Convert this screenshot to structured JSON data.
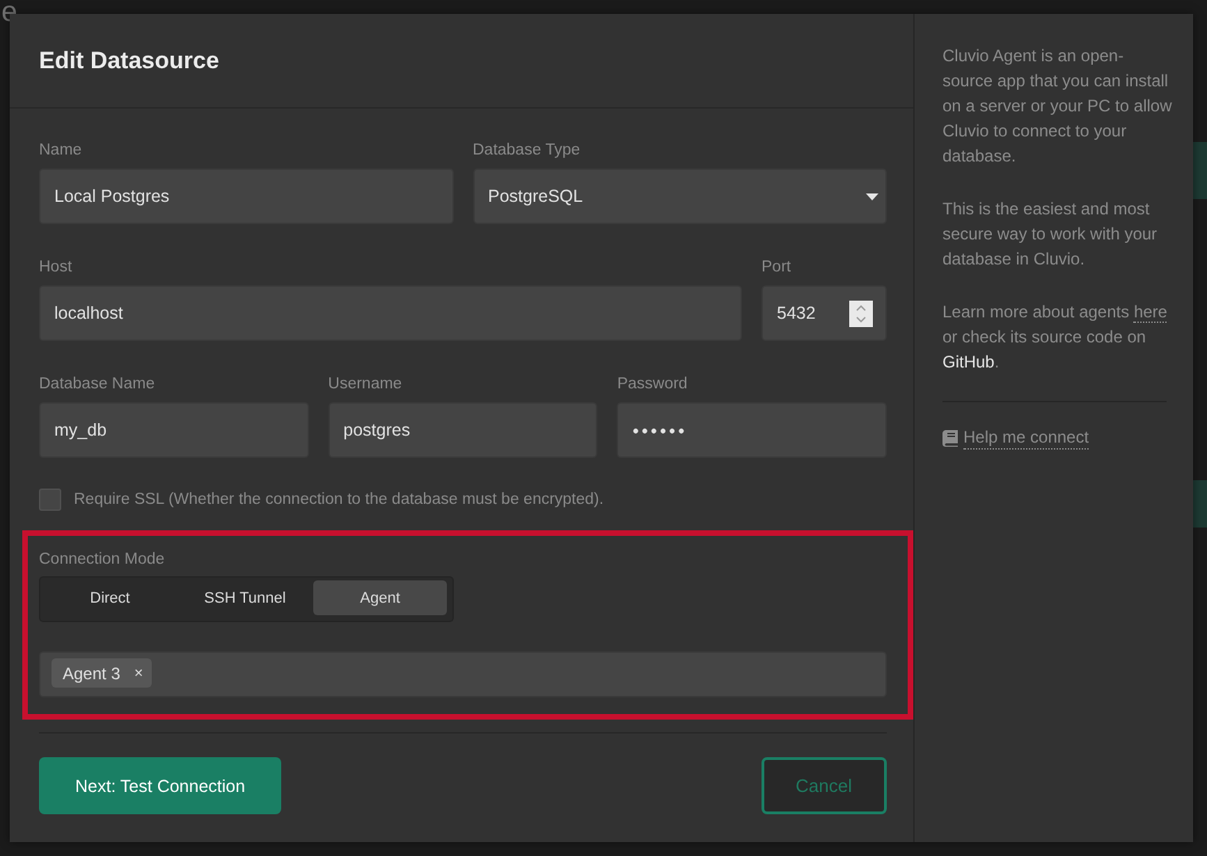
{
  "background_page": {
    "title": "e"
  },
  "dialog": {
    "title": "Edit Datasource",
    "rows": [
      [
        {
          "label": "Name",
          "kind": "text",
          "value": "Local Postgres"
        },
        {
          "label": "Database Type",
          "kind": "select",
          "value": "PostgreSQL"
        }
      ],
      [
        {
          "label": "Host",
          "kind": "text",
          "value": "localhost"
        },
        {
          "label": "Port",
          "kind": "number",
          "value": "5432"
        }
      ],
      [
        {
          "label": "Database Name",
          "kind": "text",
          "value": "my_db"
        },
        {
          "label": "Username",
          "kind": "text",
          "value": "postgres"
        },
        {
          "label": "Password",
          "kind": "password",
          "value": "••••••"
        }
      ]
    ],
    "ssl": {
      "label": "Require SSL (Whether the connection to the database must be encrypted).",
      "checked": false
    },
    "connection_mode": {
      "label": "Connection Mode",
      "highlighted": true,
      "options": [
        {
          "label": "Direct",
          "selected": false
        },
        {
          "label": "SSH Tunnel",
          "selected": false
        },
        {
          "label": "Agent",
          "selected": true
        }
      ],
      "agents": [
        {
          "label": "Agent 3",
          "remove": "×"
        }
      ]
    },
    "buttons": [
      {
        "label": "Next: Test Connection",
        "kind": "primary"
      },
      {
        "label": "Cancel",
        "kind": "outline"
      }
    ]
  },
  "help_panel": {
    "paragraphs": [
      [
        {
          "text": "Cluvio Agent is an open-source app that you can install on a server or your PC to allow Cluvio to connect to your database.",
          "kind": "text"
        }
      ],
      [
        {
          "text": "This is the easiest and most secure way to work with your database in Cluvio.",
          "kind": "text"
        }
      ],
      [
        {
          "text": "Learn more about agents ",
          "kind": "text"
        },
        {
          "text": "here",
          "kind": "dotted-link"
        },
        {
          "text": " or check its source code on ",
          "kind": "text"
        },
        {
          "text": "GitHub",
          "kind": "plain-link"
        },
        {
          "text": ".",
          "kind": "text"
        }
      ]
    ],
    "link": "Help me connect"
  }
}
